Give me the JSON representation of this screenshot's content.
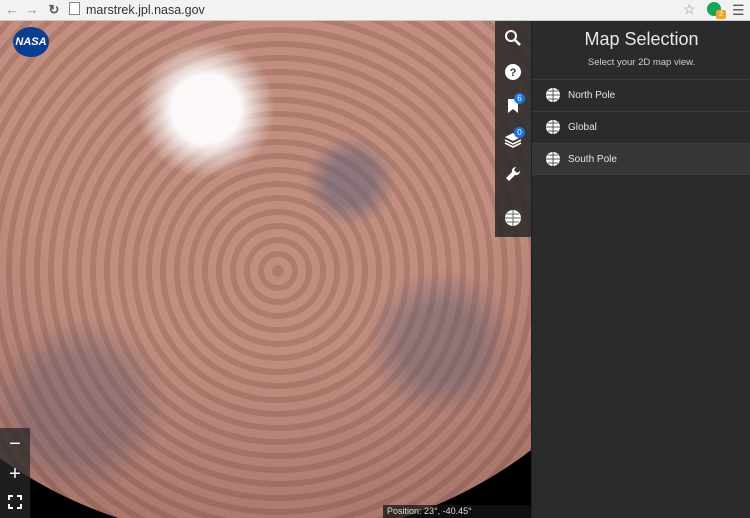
{
  "browser": {
    "url": "marstrek.jpl.nasa.gov",
    "extension_badge": "2"
  },
  "map": {
    "logo_text": "NASA",
    "bookmarks_count": "6",
    "layers_count": "0",
    "position_label": "Position:",
    "position_value": "23°, -40.45°",
    "zoom_out": "−",
    "zoom_in": "+"
  },
  "panel": {
    "title": "Map Selection",
    "subtitle": "Select your 2D map view.",
    "options": [
      {
        "label": "North Pole"
      },
      {
        "label": "Global"
      },
      {
        "label": "South Pole"
      }
    ],
    "selected": "South Pole"
  }
}
